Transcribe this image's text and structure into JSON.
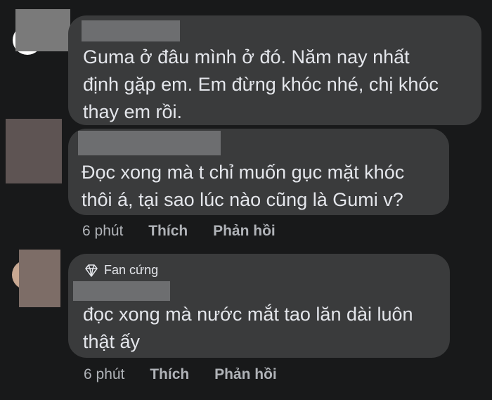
{
  "comments": [
    {
      "author": "",
      "text_lines": [
        "Guma ở đâu mình ở đó. Năm nay nhất",
        "định gặp em. Em đừng khóc nhé, chị khóc",
        "thay em rồi."
      ]
    },
    {
      "author": "",
      "text_lines": [
        "Đọc xong mà t chỉ muốn gục mặt khóc",
        "thôi á, tại sao lúc nào cũng là Gumi v?"
      ],
      "time": "6 phút",
      "like_label": "Thích",
      "reply_label": "Phản hồi"
    },
    {
      "author": "",
      "badge": "Fan cứng",
      "badge_icon": "diamond-icon",
      "text_lines": [
        "đọc xong mà nước mắt tao lăn dài luôn",
        "thật ấy"
      ],
      "time": "6 phút",
      "like_label": "Thích",
      "reply_label": "Phản hồi"
    }
  ],
  "colors": {
    "background": "#18191a",
    "bubble": "#3a3b3c",
    "text": "#e4e6eb",
    "meta_text": "#b0b3b8",
    "redaction": "#6d6e70"
  }
}
